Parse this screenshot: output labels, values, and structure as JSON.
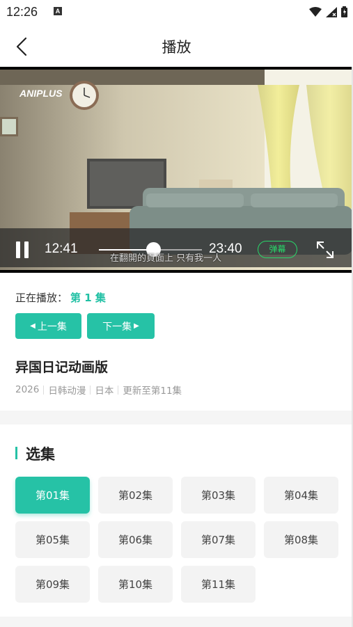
{
  "status": {
    "time": "12:26",
    "notification_icon": "A"
  },
  "header": {
    "title": "播放",
    "back_icon": "chevron-left-icon"
  },
  "player": {
    "brand": "ANIPLUS",
    "current_time": "12:41",
    "total_time": "23:40",
    "progress": 0.53,
    "subtitle": "在翻開的頁面上 只有我一人",
    "danmaku_label": "弹幕"
  },
  "info": {
    "now_playing_label": "正在播放：",
    "now_playing_episode": "第 1 集",
    "prev_label": "上一集",
    "next_label": "下一集",
    "show_title": "异国日记动画版",
    "meta": [
      "2026",
      "日韩动漫",
      "日本",
      "更新至第11集"
    ]
  },
  "episodes": {
    "section_title": "选集",
    "items": [
      "第01集",
      "第02集",
      "第03集",
      "第04集",
      "第05集",
      "第06集",
      "第07集",
      "第08集",
      "第09集",
      "第10集",
      "第11集"
    ],
    "selected": 0
  },
  "colors": {
    "accent": "#26c2a6",
    "danmaku": "#28d86a"
  }
}
